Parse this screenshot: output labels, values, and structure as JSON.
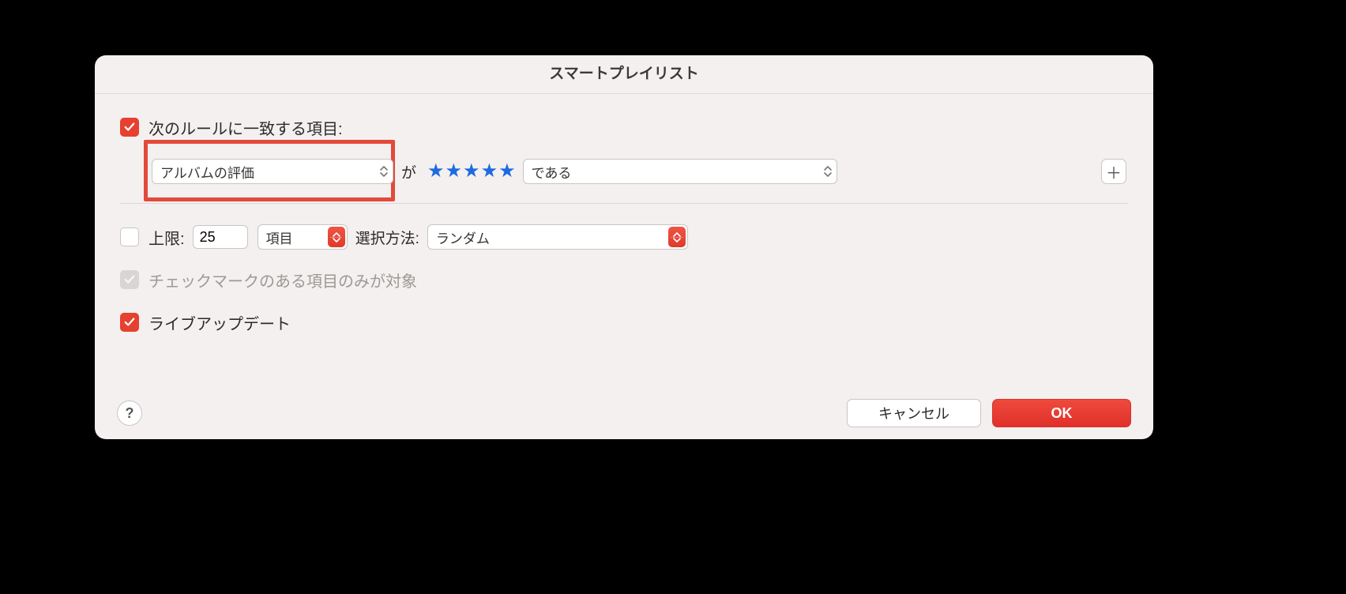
{
  "title": "スマートプレイリスト",
  "match": {
    "checkbox_checked": true,
    "label": "次のルールに一致する項目:"
  },
  "rule": {
    "field": "アルバムの評価",
    "joiner": "が",
    "star_count": 5,
    "operator": "である"
  },
  "limit": {
    "checkbox_checked": false,
    "label": "上限:",
    "value": "25",
    "unit": "項目",
    "method_label": "選択方法:",
    "method": "ランダム"
  },
  "checked_only": {
    "checkbox_checked": true,
    "disabled": true,
    "label": "チェックマークのある項目のみが対象"
  },
  "live_update": {
    "checkbox_checked": true,
    "label": "ライブアップデート"
  },
  "buttons": {
    "help": "?",
    "cancel": "キャンセル",
    "ok": "OK",
    "add": "＋"
  }
}
